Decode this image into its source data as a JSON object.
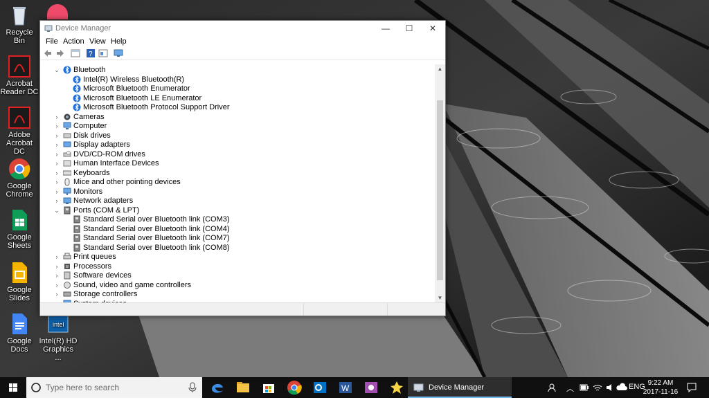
{
  "desktop": {
    "icons": [
      {
        "label": "Recycle Bin",
        "icon": "recycle-bin-icon"
      },
      {
        "label": "Acrobat Reader DC",
        "icon": "acrobat-reader-icon"
      },
      {
        "label": "Adobe Acrobat DC",
        "icon": "adobe-acrobat-icon"
      },
      {
        "label": "Google Chrome",
        "icon": "chrome-icon"
      },
      {
        "label": "Google Sheets",
        "icon": "sheets-icon"
      },
      {
        "label": "Google Slides",
        "icon": "slides-icon"
      },
      {
        "label": "Google Docs",
        "icon": "docs-icon"
      },
      {
        "label": "Intel(R) HD Graphics ...",
        "icon": "intel-graphics-icon"
      }
    ]
  },
  "window": {
    "title": "Device Manager",
    "controls": {
      "minimize": "—",
      "maximize": "☐",
      "close": "✕"
    },
    "menu": [
      "File",
      "Action",
      "View",
      "Help"
    ],
    "tree": [
      {
        "label": "Bluetooth",
        "expanded": true,
        "icon": "bluetooth-icon",
        "children": [
          {
            "label": "Intel(R) Wireless Bluetooth(R)",
            "icon": "bluetooth-icon"
          },
          {
            "label": "Microsoft Bluetooth Enumerator",
            "icon": "bluetooth-icon"
          },
          {
            "label": "Microsoft Bluetooth LE Enumerator",
            "icon": "bluetooth-icon"
          },
          {
            "label": "Microsoft Bluetooth Protocol Support Driver",
            "icon": "bluetooth-icon"
          }
        ]
      },
      {
        "label": "Cameras",
        "icon": "camera-icon"
      },
      {
        "label": "Computer",
        "icon": "computer-icon"
      },
      {
        "label": "Disk drives",
        "icon": "disk-drive-icon"
      },
      {
        "label": "Display adapters",
        "icon": "display-adapter-icon"
      },
      {
        "label": "DVD/CD-ROM drives",
        "icon": "dvd-drive-icon"
      },
      {
        "label": "Human Interface Devices",
        "icon": "hid-icon"
      },
      {
        "label": "Keyboards",
        "icon": "keyboard-icon"
      },
      {
        "label": "Mice and other pointing devices",
        "icon": "mouse-icon"
      },
      {
        "label": "Monitors",
        "icon": "monitor-icon"
      },
      {
        "label": "Network adapters",
        "icon": "network-adapter-icon"
      },
      {
        "label": "Ports (COM & LPT)",
        "expanded": true,
        "icon": "port-icon",
        "children": [
          {
            "label": "Standard Serial over Bluetooth link (COM3)",
            "icon": "port-icon"
          },
          {
            "label": "Standard Serial over Bluetooth link (COM4)",
            "icon": "port-icon"
          },
          {
            "label": "Standard Serial over Bluetooth link (COM7)",
            "icon": "port-icon"
          },
          {
            "label": "Standard Serial over Bluetooth link (COM8)",
            "icon": "port-icon"
          }
        ]
      },
      {
        "label": "Print queues",
        "icon": "printer-icon"
      },
      {
        "label": "Processors",
        "icon": "processor-icon"
      },
      {
        "label": "Software devices",
        "icon": "software-device-icon"
      },
      {
        "label": "Sound, video and game controllers",
        "icon": "sound-icon"
      },
      {
        "label": "Storage controllers",
        "icon": "storage-controller-icon"
      },
      {
        "label": "System devices",
        "icon": "system-device-icon"
      }
    ]
  },
  "taskbar": {
    "search_placeholder": "Type here to search",
    "running_app": "Device Manager",
    "language": "ENG",
    "time": "9:22 AM",
    "date": "2017-11-16"
  },
  "colors": {
    "accent": "#76b9ed",
    "bluetooth": "#1e6fd9",
    "taskbar": "#101010"
  }
}
